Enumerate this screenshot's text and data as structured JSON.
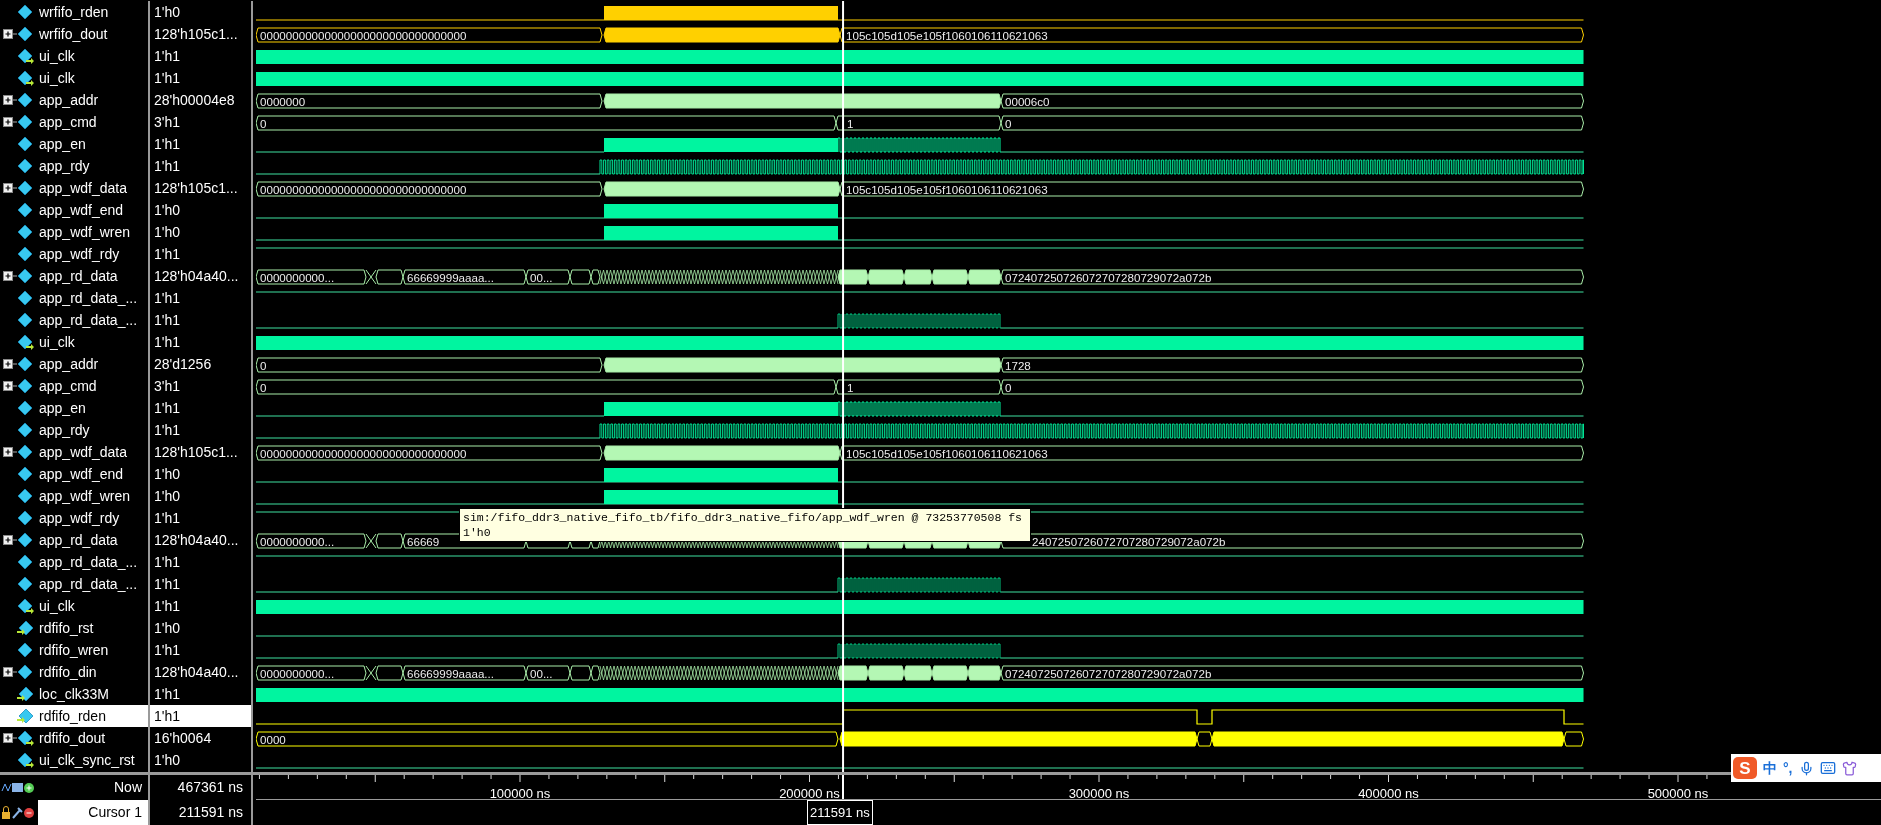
{
  "signals": [
    {
      "name": "wrfifo_rden",
      "value": "1'h0",
      "expandable": false,
      "selected": false,
      "kind": "pulse_gold"
    },
    {
      "name": "wrfifo_dout",
      "value": "128'h105c1...",
      "expandable": true,
      "selected": false,
      "kind": "bus_gold",
      "labels": [
        "00000000000000000000000000000000",
        "105c105d105e105f1060106110621063"
      ]
    },
    {
      "name": "ui_clk",
      "value": "1'h1",
      "expandable": false,
      "selected": false,
      "kind": "clock"
    },
    {
      "name": "ui_clk",
      "value": "1'h1",
      "expandable": false,
      "selected": false,
      "kind": "clock"
    },
    {
      "name": "app_addr",
      "value": "28'h00004e8",
      "expandable": true,
      "selected": false,
      "kind": "bus_addr",
      "labels": [
        "0000000",
        "00006c0"
      ]
    },
    {
      "name": "app_cmd",
      "value": "3'h1",
      "expandable": true,
      "selected": false,
      "kind": "bus_cmd",
      "labels": [
        "0",
        "1",
        "0"
      ]
    },
    {
      "name": "app_en",
      "value": "1'h1",
      "expandable": false,
      "selected": false,
      "kind": "enable"
    },
    {
      "name": "app_rdy",
      "value": "1'h1",
      "expandable": false,
      "selected": false,
      "kind": "ready"
    },
    {
      "name": "app_wdf_data",
      "value": "128'h105c1...",
      "expandable": true,
      "selected": false,
      "kind": "bus_wdf",
      "labels": [
        "00000000000000000000000000000000",
        "105c105d105e105f1060106110621063"
      ]
    },
    {
      "name": "app_wdf_end",
      "value": "1'h0",
      "expandable": false,
      "selected": false,
      "kind": "pulse"
    },
    {
      "name": "app_wdf_wren",
      "value": "1'h0",
      "expandable": false,
      "selected": false,
      "kind": "pulse"
    },
    {
      "name": "app_wdf_rdy",
      "value": "1'h1",
      "expandable": false,
      "selected": false,
      "kind": "high"
    },
    {
      "name": "app_rd_data",
      "value": "128'h04a40...",
      "expandable": true,
      "selected": false,
      "kind": "rd_bus",
      "labels": [
        "0000000000...",
        "66669999aaaa...",
        "00...",
        "072407250726072707280729072a072b"
      ]
    },
    {
      "name": "app_rd_data_...",
      "value": "1'h1",
      "expandable": false,
      "selected": false,
      "kind": "high"
    },
    {
      "name": "app_rd_data_...",
      "value": "1'h1",
      "expandable": false,
      "selected": false,
      "kind": "burst"
    },
    {
      "name": "ui_clk",
      "value": "1'h1",
      "expandable": false,
      "selected": false,
      "kind": "clock"
    },
    {
      "name": "app_addr",
      "value": "28'd1256",
      "expandable": true,
      "selected": false,
      "kind": "bus_addr",
      "labels": [
        "0",
        "1728"
      ]
    },
    {
      "name": "app_cmd",
      "value": "3'h1",
      "expandable": true,
      "selected": false,
      "kind": "bus_cmd",
      "labels": [
        "0",
        "1",
        "0"
      ]
    },
    {
      "name": "app_en",
      "value": "1'h1",
      "expandable": false,
      "selected": false,
      "kind": "enable"
    },
    {
      "name": "app_rdy",
      "value": "1'h1",
      "expandable": false,
      "selected": false,
      "kind": "ready"
    },
    {
      "name": "app_wdf_data",
      "value": "128'h105c1...",
      "expandable": true,
      "selected": false,
      "kind": "bus_wdf",
      "labels": [
        "00000000000000000000000000000000",
        "105c105d105e105f1060106110621063"
      ]
    },
    {
      "name": "app_wdf_end",
      "value": "1'h0",
      "expandable": false,
      "selected": false,
      "kind": "pulse"
    },
    {
      "name": "app_wdf_wren",
      "value": "1'h0",
      "expandable": false,
      "selected": false,
      "kind": "pulse"
    },
    {
      "name": "app_wdf_rdy",
      "value": "1'h1",
      "expandable": false,
      "selected": false,
      "kind": "high"
    },
    {
      "name": "app_rd_data",
      "value": "128'h04a40...",
      "expandable": true,
      "selected": false,
      "kind": "rd_bus_covered",
      "labels": [
        "0000000000...",
        "66669",
        "2407250726072707280729072a072b"
      ]
    },
    {
      "name": "app_rd_data_...",
      "value": "1'h1",
      "expandable": false,
      "selected": false,
      "kind": "high"
    },
    {
      "name": "app_rd_data_...",
      "value": "1'h1",
      "expandable": false,
      "selected": false,
      "kind": "burst"
    },
    {
      "name": "ui_clk",
      "value": "1'h1",
      "expandable": false,
      "selected": false,
      "kind": "clock"
    },
    {
      "name": "rdfifo_rst",
      "value": "1'h0",
      "expandable": false,
      "selected": false,
      "kind": "low"
    },
    {
      "name": "rdfifo_wren",
      "value": "1'h1",
      "expandable": false,
      "selected": false,
      "kind": "burst"
    },
    {
      "name": "rdfifo_din",
      "value": "128'h04a40...",
      "expandable": true,
      "selected": false,
      "kind": "rd_bus",
      "labels": [
        "0000000000...",
        "66669999aaaa...",
        "00...",
        "072407250726072707280729072a072b"
      ]
    },
    {
      "name": "loc_clk33M",
      "value": "1'h1",
      "expandable": false,
      "selected": false,
      "kind": "clock"
    },
    {
      "name": "rdfifo_rden",
      "value": "1'h1",
      "expandable": false,
      "selected": true,
      "kind": "rden"
    },
    {
      "name": "rdfifo_dout",
      "value": "16'h0064",
      "expandable": true,
      "selected": false,
      "kind": "bus_dout",
      "labels": [
        "0000"
      ]
    },
    {
      "name": "ui_clk_sync_rst",
      "value": "1'h0",
      "expandable": false,
      "selected": false,
      "kind": "low"
    }
  ],
  "cursor_rows": [
    {
      "label": "Now",
      "value": "467361 ns",
      "selected": false
    },
    {
      "label": "Cursor 1",
      "value": "211591 ns",
      "selected": true
    }
  ],
  "timeline": {
    "labels": [
      "100000 ns",
      "200000 ns",
      "300000 ns",
      "400000 ns",
      "500000 ns"
    ],
    "cursor_label": "211591 ns"
  },
  "tooltip": {
    "lines": [
      "sim:/fifo_ddr3_native_fifo_tb/fifo_ddr3_native_fifo/app_wdf_wren @ 73253770508 fs",
      "1'h0"
    ]
  },
  "ime_bar": {
    "logo": "S",
    "items": [
      "中",
      "°,"
    ]
  }
}
